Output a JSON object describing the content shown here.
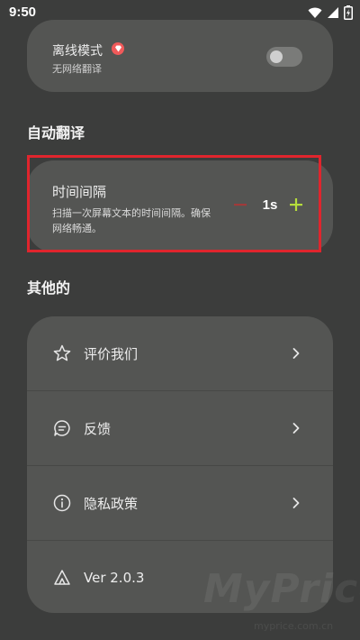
{
  "status_bar": {
    "time": "9:50",
    "icons": [
      "wifi-icon",
      "signal-icon",
      "battery-charging-icon"
    ]
  },
  "offline": {
    "title": "离线模式",
    "subtitle": "无网络翻译",
    "enabled": false,
    "badge_icon": "premium-gem-icon"
  },
  "sections": {
    "auto_translate": "自动翻译",
    "other": "其他的"
  },
  "interval": {
    "title": "时间间隔",
    "description": "扫描一次屏幕文本的时间间隔。确保网络畅通。",
    "value": "1s",
    "minus_symbol": "−",
    "plus_symbol": "+"
  },
  "other_items": [
    {
      "label": "评价我们",
      "icon": "star-icon"
    },
    {
      "label": "反馈",
      "icon": "chat-bubble-icon"
    },
    {
      "label": "隐私政策",
      "icon": "info-icon"
    },
    {
      "label": "Ver 2.0.3",
      "icon": "tent-icon"
    }
  ],
  "watermark": {
    "text": "MyPrice",
    "sub": "myprice.com.cn"
  },
  "colors": {
    "background": "#3c3d3c",
    "card": "#545553",
    "highlight": "#e0252d",
    "accent_green": "#b5dc3c",
    "minus_red": "#a03a3a"
  }
}
